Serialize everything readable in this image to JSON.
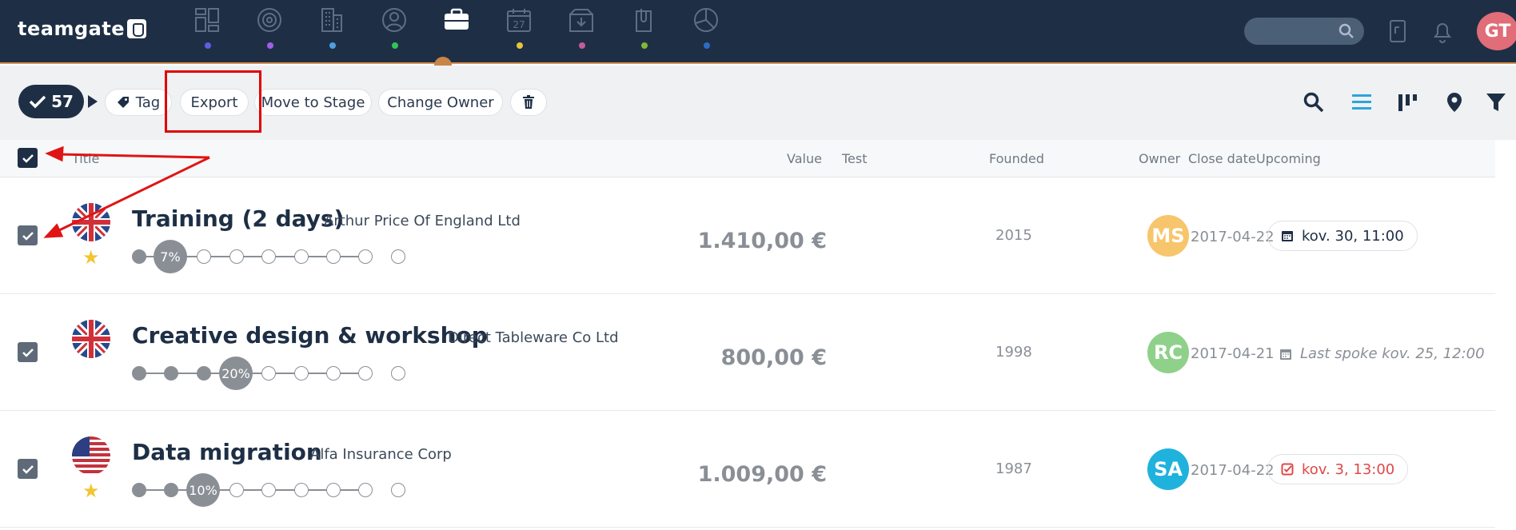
{
  "app": {
    "logo_text": "teamgate"
  },
  "nav": {
    "items": [
      {
        "icon": "dashboard-icon",
        "dot_color": "#5b5fe0",
        "label": ""
      },
      {
        "icon": "target-icon",
        "dot_color": "#a35ee6",
        "label": ""
      },
      {
        "icon": "building-icon",
        "dot_color": "#4f9fe3",
        "label": ""
      },
      {
        "icon": "contacts-icon",
        "dot_color": "#34c25a",
        "label": ""
      },
      {
        "icon": "briefcase-icon",
        "dot_color": "",
        "label": ""
      },
      {
        "icon": "calendar-icon",
        "dot_color": "#e6c43c",
        "label": "27"
      },
      {
        "icon": "inbox-download-icon",
        "dot_color": "#c45a9e",
        "label": ""
      },
      {
        "icon": "attachment-icon",
        "dot_color": "#7fb832",
        "label": ""
      },
      {
        "icon": "pie-chart-icon",
        "dot_color": "#2b6cc4",
        "label": ""
      }
    ],
    "active_index": 4
  },
  "user": {
    "initials": "GT",
    "color": "#e06d78"
  },
  "toolbar": {
    "selected_count": "57",
    "tag_label": "Tag",
    "export_label": "Export",
    "move_label": "Move to Stage",
    "owner_label": "Change Owner"
  },
  "columns": {
    "title": "Title",
    "value": "Value",
    "test": "Test",
    "founded": "Founded",
    "owner": "Owner",
    "close_date": "Close date",
    "upcoming": "Upcoming"
  },
  "rows": [
    {
      "title": "Training (2 days)",
      "company": "Arthur Price Of England Ltd",
      "flag": "uk-flag-icon",
      "starred": true,
      "star": "★",
      "stage_percent": "7%",
      "stage_index": 1,
      "value": "1.410,00 €",
      "founded": "2015",
      "owner_initials": "MS",
      "owner_color": "#f7c56b",
      "close_date": "2017-04-22",
      "upcoming": "kov. 30, 11:00",
      "upcoming_style": "calendar"
    },
    {
      "title": "Creative design & workshop",
      "company": "Direct Tableware Co Ltd",
      "flag": "uk-flag-icon",
      "starred": false,
      "star": "",
      "stage_percent": "20%",
      "stage_index": 3,
      "value": "800,00 €",
      "founded": "1998",
      "owner_initials": "RC",
      "owner_color": "#8fd18a",
      "close_date": "2017-04-21",
      "upcoming": "Last spoke kov. 25, 12:00",
      "upcoming_style": "last-spoke"
    },
    {
      "title": "Data migration",
      "company": "Alfa Insurance Corp",
      "flag": "us-flag-icon",
      "starred": true,
      "star": "★",
      "stage_percent": "10%",
      "stage_index": 2,
      "value": "1.009,00 €",
      "founded": "1987",
      "owner_initials": "SA",
      "owner_color": "#1fb2dd",
      "close_date": "2017-04-22",
      "upcoming": "kov. 3, 13:00",
      "upcoming_style": "overdue"
    }
  ]
}
